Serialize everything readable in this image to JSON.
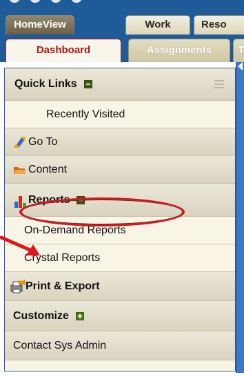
{
  "main_tabs": [
    {
      "label": "HomeView",
      "active": true
    },
    {
      "label": "Work",
      "active": false
    },
    {
      "label": "Reso",
      "active": false
    }
  ],
  "sub_tabs": [
    {
      "label": "Dashboard",
      "active": true
    },
    {
      "label": "Assignments",
      "active": false
    },
    {
      "label": "T",
      "active": false
    }
  ],
  "sidebar": {
    "quick_links": {
      "label": "Quick Links",
      "toggle": "minus"
    },
    "recently_visited": {
      "label": "Recently Visited"
    },
    "go_to": {
      "label": "Go To",
      "icon": "goto-arrow-icon"
    },
    "content": {
      "label": "Content",
      "icon": "folder-icon"
    },
    "reports": {
      "label": "Reports",
      "icon": "bar-chart-icon",
      "toggle": "minus"
    },
    "on_demand_reports": {
      "label": "On-Demand Reports"
    },
    "crystal_reports": {
      "label": "Crystal Reports"
    },
    "print_export": {
      "label": "Print & Export",
      "icon": "print-export-icon"
    },
    "customize": {
      "label": "Customize",
      "toggle": "plus"
    },
    "contact_sys_admin": {
      "label": "Contact Sys Admin"
    }
  },
  "colors": {
    "nav_blue": "#1f5a99",
    "active_tab": "#b5121b",
    "annotation_red": "#d0181f",
    "panel_bg": "#f7f4e6"
  }
}
